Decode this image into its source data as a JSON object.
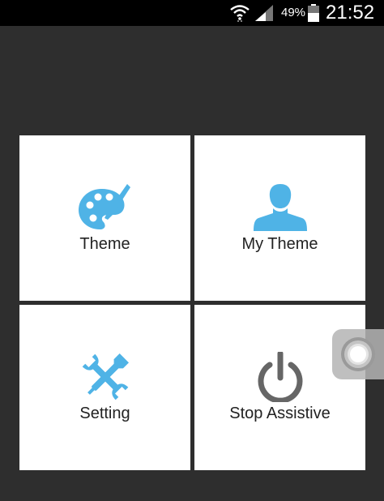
{
  "status_bar": {
    "battery_percent": "49%",
    "time": "21:52",
    "icons": [
      "wifi-icon",
      "signal-icon",
      "battery-icon"
    ]
  },
  "menu": {
    "tiles": [
      {
        "label": "Theme",
        "icon": "palette-icon"
      },
      {
        "label": "My Theme",
        "icon": "person-icon"
      },
      {
        "label": "Setting",
        "icon": "tools-icon"
      },
      {
        "label": "Stop Assistive",
        "icon": "power-icon"
      }
    ]
  },
  "colors": {
    "background": "#2e2e2e",
    "tile_background": "#ffffff",
    "icon_blue": "#4fb3e6",
    "icon_gray": "#666666"
  },
  "floating": {
    "icon": "assistive-touch-icon"
  }
}
